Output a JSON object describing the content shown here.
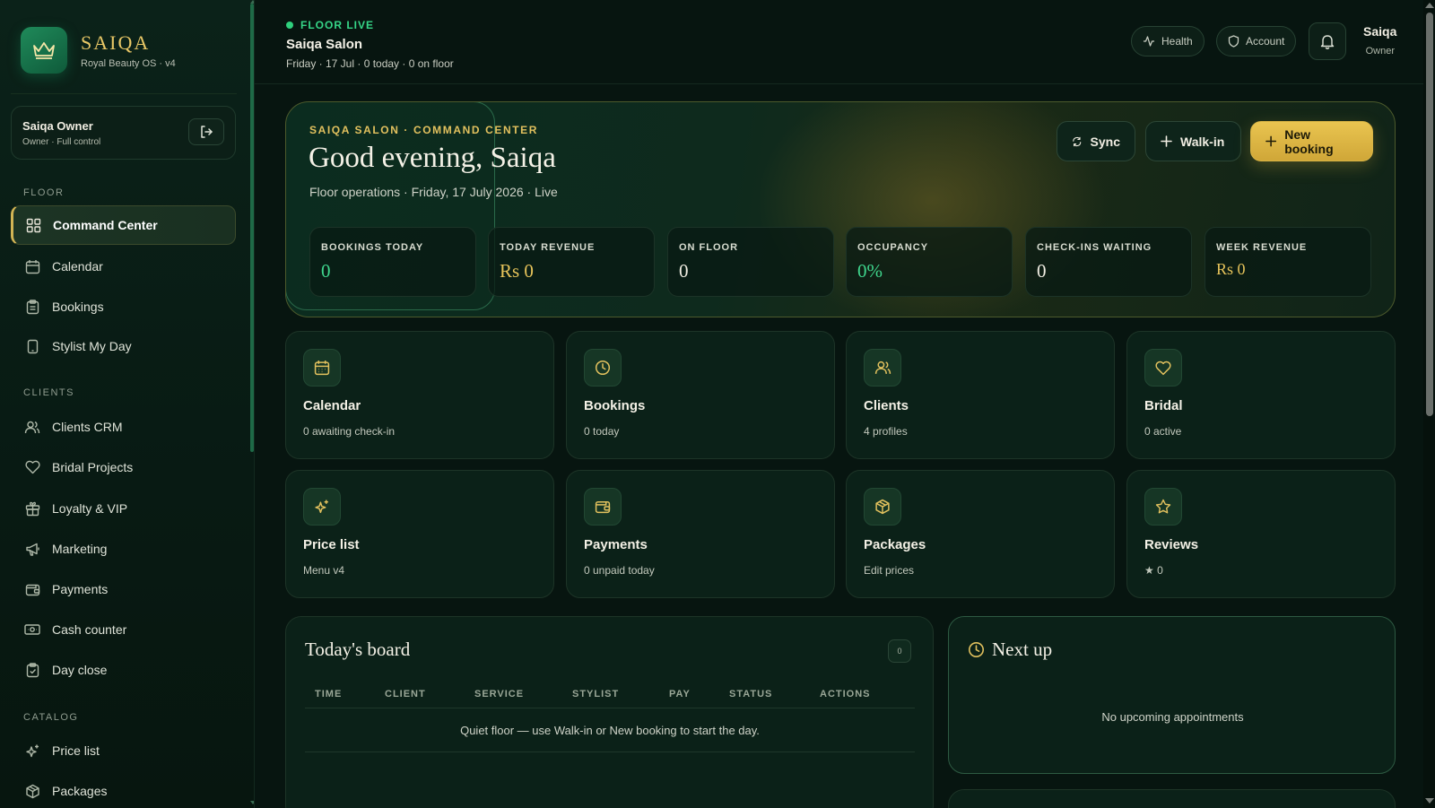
{
  "brand": {
    "name": "SAIQA",
    "subtitle": "Royal Beauty OS · v4"
  },
  "owner": {
    "name": "Saiqa Owner",
    "role": "Owner · Full control"
  },
  "sidebar": {
    "sections": [
      {
        "label": "FLOOR"
      },
      {
        "label": "CLIENTS"
      },
      {
        "label": "CATALOG"
      }
    ],
    "items": [
      {
        "label": "Command Center",
        "icon": "grid-icon"
      },
      {
        "label": "Calendar",
        "icon": "calendar-icon"
      },
      {
        "label": "Bookings",
        "icon": "clipboard-icon"
      },
      {
        "label": "Stylist My Day",
        "icon": "tablet-icon"
      },
      {
        "label": "Clients CRM",
        "icon": "users-icon"
      },
      {
        "label": "Bridal Projects",
        "icon": "heart-icon"
      },
      {
        "label": "Loyalty & VIP",
        "icon": "gift-icon"
      },
      {
        "label": "Marketing",
        "icon": "megaphone-icon"
      },
      {
        "label": "Payments",
        "icon": "wallet-icon"
      },
      {
        "label": "Cash counter",
        "icon": "banknote-icon"
      },
      {
        "label": "Day close",
        "icon": "clipboard-check-icon"
      },
      {
        "label": "Price list",
        "icon": "sparkles-icon"
      },
      {
        "label": "Packages",
        "icon": "package-icon"
      }
    ]
  },
  "topbar": {
    "live_label": "FLOOR LIVE",
    "salon_name": "Saiqa Salon",
    "meta": "Friday · 17 Jul · 0 today · 0 on floor",
    "health_label": "Health",
    "account_label": "Account",
    "user_name": "Saiqa",
    "user_role": "Owner"
  },
  "hero": {
    "eyebrow": "SAIQA SALON · COMMAND CENTER",
    "title": "Good evening, Saiqa",
    "subtitle": "Floor operations · Friday, 17 July 2026 · Live",
    "sync_label": "Sync",
    "walkin_label": "Walk-in",
    "new_booking_label": "New booking",
    "stats": [
      {
        "label": "BOOKINGS TODAY",
        "value": "0",
        "color": "#3fd68d"
      },
      {
        "label": "TODAY REVENUE",
        "value": "Rs 0",
        "color": "#e6c35a"
      },
      {
        "label": "ON FLOOR",
        "value": "0",
        "color": "#f2efe4"
      },
      {
        "label": "OCCUPANCY",
        "value": "0%",
        "color": "#3fd68d"
      },
      {
        "label": "CHECK-INS WAITING",
        "value": "0",
        "color": "#f2efe4"
      },
      {
        "label": "WEEK REVENUE",
        "value": "Rs 0",
        "color": "#e6c35a"
      }
    ]
  },
  "tiles": [
    {
      "title": "Calendar",
      "subtitle": "0 awaiting check-in",
      "icon": "calendar-icon"
    },
    {
      "title": "Bookings",
      "subtitle": "0 today",
      "icon": "clock-icon"
    },
    {
      "title": "Clients",
      "subtitle": "4 profiles",
      "icon": "users-icon"
    },
    {
      "title": "Bridal",
      "subtitle": "0 active",
      "icon": "heart-icon"
    },
    {
      "title": "Price list",
      "subtitle": "Menu v4",
      "icon": "sparkles-icon"
    },
    {
      "title": "Payments",
      "subtitle": "0 unpaid today",
      "icon": "wallet-icon"
    },
    {
      "title": "Packages",
      "subtitle": "Edit prices",
      "icon": "package-icon"
    },
    {
      "title": "Reviews",
      "subtitle": "★ 0",
      "icon": "star-icon"
    }
  ],
  "board": {
    "title": "Today's board",
    "count": "0",
    "columns": [
      "TIME",
      "CLIENT",
      "SERVICE",
      "STYLIST",
      "PAY",
      "STATUS",
      "ACTIONS"
    ],
    "empty": "Quiet floor — use Walk-in or New booking to start the day."
  },
  "nextup": {
    "title": "Next up",
    "empty": "No upcoming appointments"
  },
  "colors": {
    "accent_gold": "#e2c15e",
    "live_green": "#2fd07d",
    "background": "#071510"
  }
}
